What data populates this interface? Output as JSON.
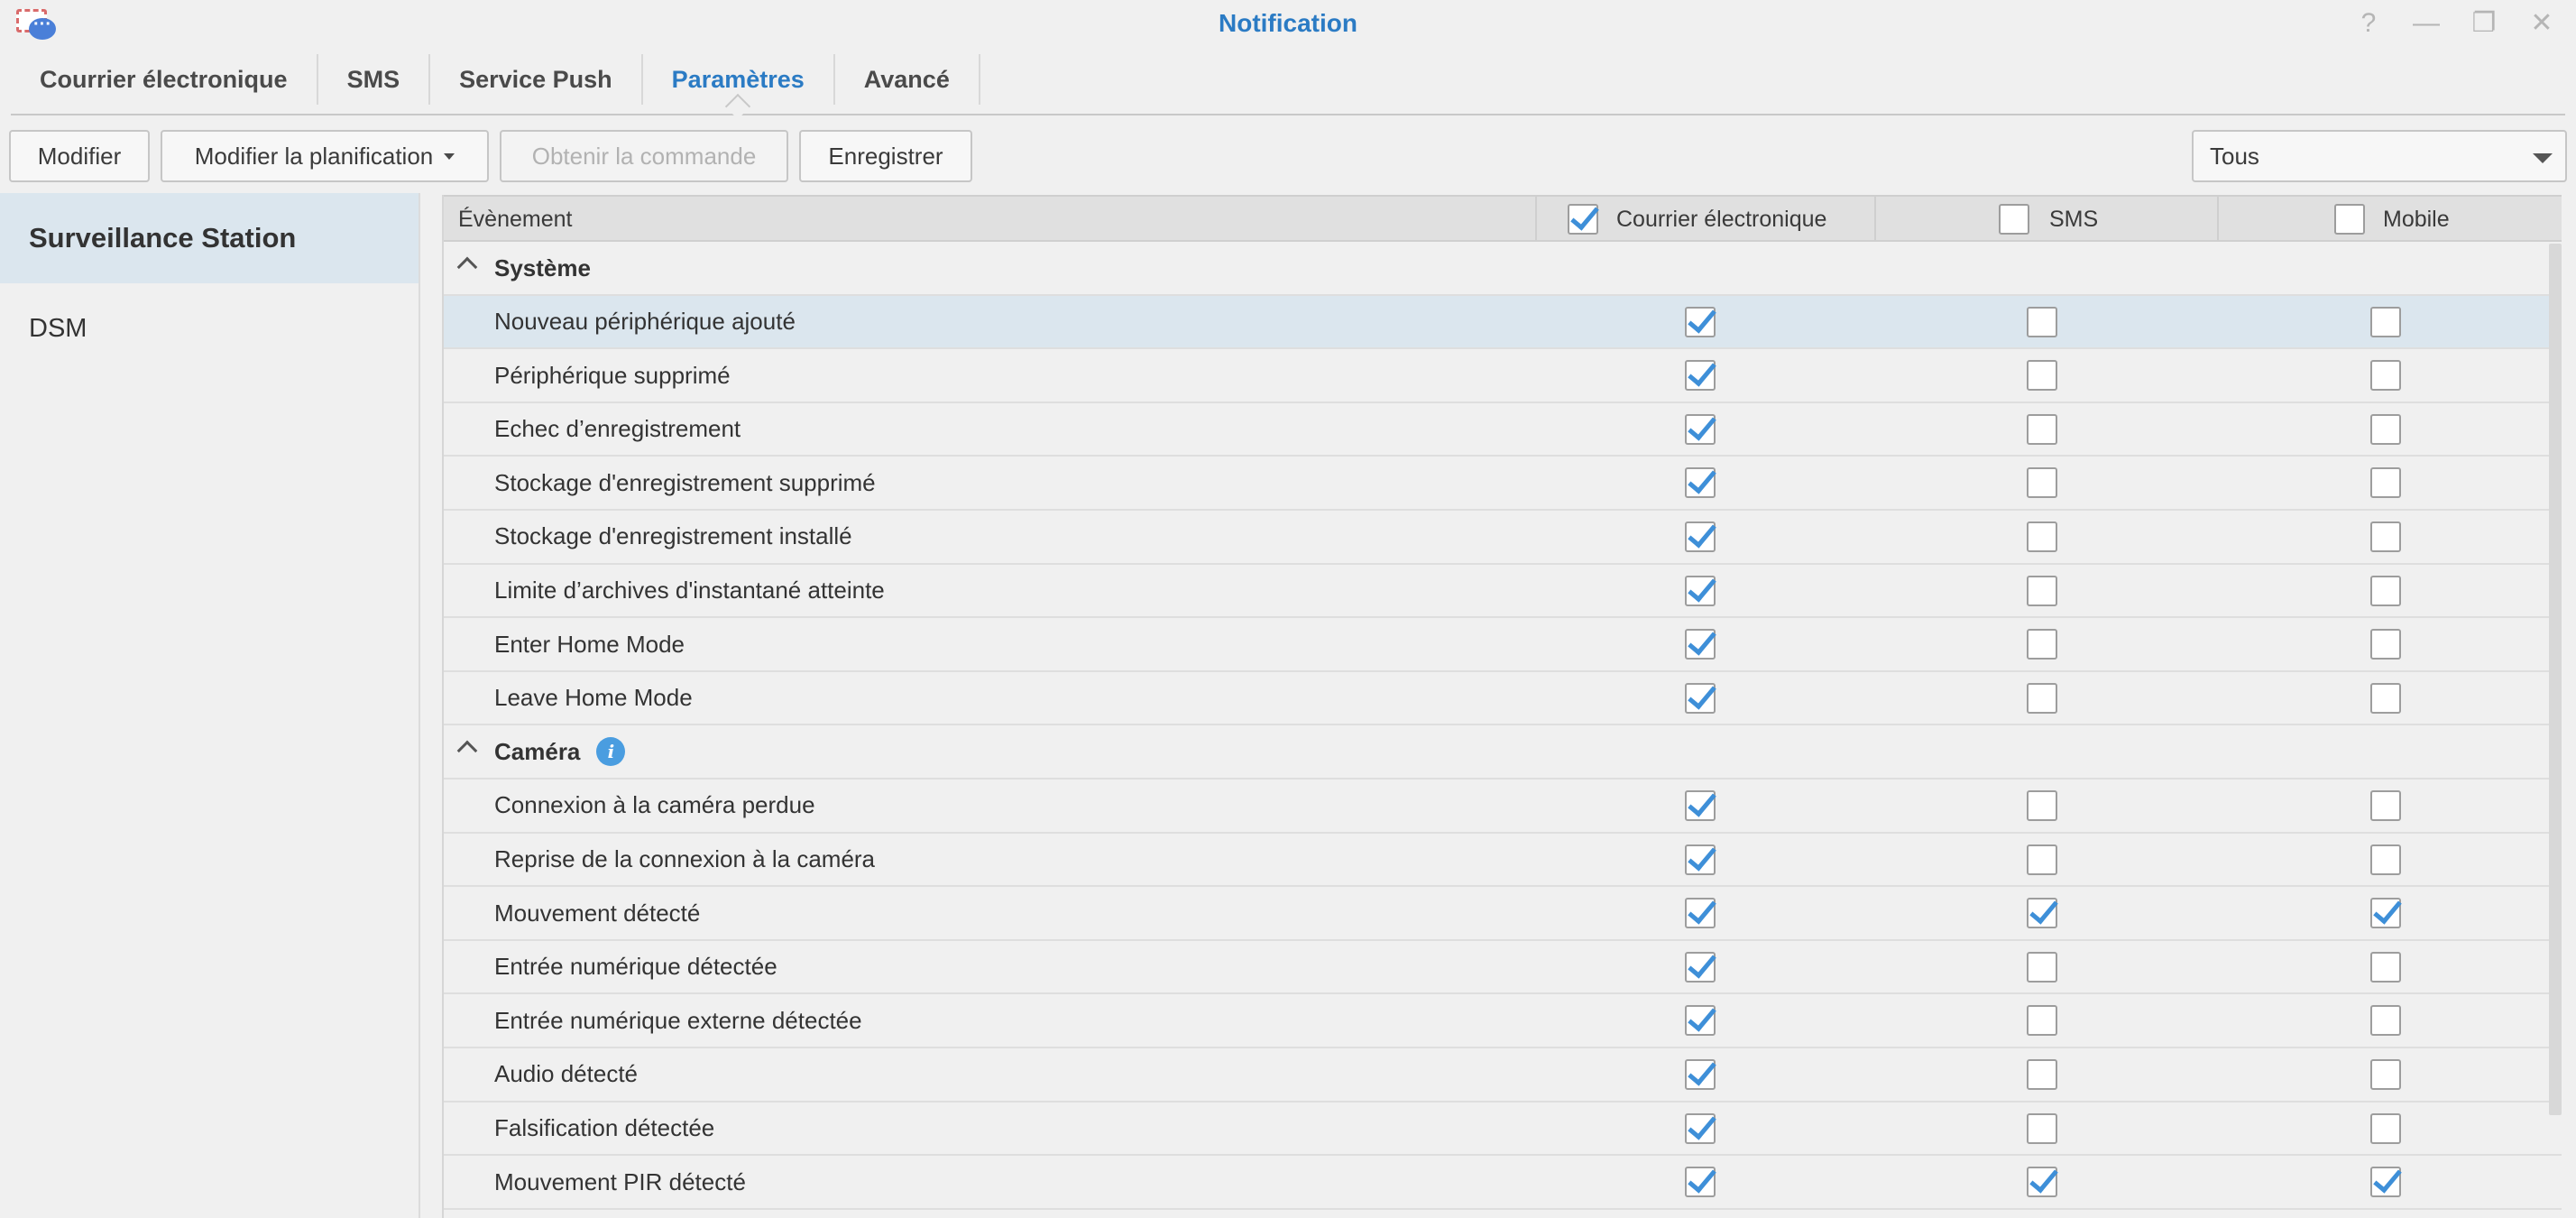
{
  "window": {
    "title": "Notification",
    "controls": [
      "help-icon",
      "minimize-icon",
      "restore-icon",
      "close-icon"
    ]
  },
  "tabs": [
    {
      "label": "Courrier électronique",
      "active": false
    },
    {
      "label": "SMS",
      "active": false
    },
    {
      "label": "Service Push",
      "active": false
    },
    {
      "label": "Paramètres",
      "active": true
    },
    {
      "label": "Avancé",
      "active": false
    }
  ],
  "toolbar": {
    "edit": "Modifier",
    "edit_schedule": "Modifier la planification",
    "get_command": "Obtenir la commande",
    "save": "Enregistrer",
    "filter_value": "Tous"
  },
  "sidebar": {
    "items": [
      {
        "label": "Surveillance Station",
        "active": true
      },
      {
        "label": "DSM",
        "active": false
      }
    ]
  },
  "grid": {
    "columns": {
      "event": "Évènement",
      "email": {
        "label": "Courrier électronique",
        "checked": true
      },
      "sms": {
        "label": "SMS",
        "checked": false
      },
      "mobile": {
        "label": "Mobile",
        "checked": false
      }
    },
    "groups": [
      {
        "label": "Système",
        "info": false,
        "rows": [
          {
            "label": "Nouveau périphérique ajouté",
            "email": true,
            "sms": false,
            "mobile": false,
            "selected": true
          },
          {
            "label": "Périphérique supprimé",
            "email": true,
            "sms": false,
            "mobile": false
          },
          {
            "label": "Echec d’enregistrement",
            "email": true,
            "sms": false,
            "mobile": false
          },
          {
            "label": "Stockage d'enregistrement supprimé",
            "email": true,
            "sms": false,
            "mobile": false
          },
          {
            "label": "Stockage d'enregistrement installé",
            "email": true,
            "sms": false,
            "mobile": false
          },
          {
            "label": "Limite d’archives d'instantané atteinte",
            "email": true,
            "sms": false,
            "mobile": false
          },
          {
            "label": "Enter Home Mode",
            "email": true,
            "sms": false,
            "mobile": false
          },
          {
            "label": "Leave Home Mode",
            "email": true,
            "sms": false,
            "mobile": false
          }
        ]
      },
      {
        "label": "Caméra",
        "info": true,
        "rows": [
          {
            "label": "Connexion à la caméra perdue",
            "email": true,
            "sms": false,
            "mobile": false
          },
          {
            "label": "Reprise de la connexion à la caméra",
            "email": true,
            "sms": false,
            "mobile": false
          },
          {
            "label": "Mouvement détecté",
            "email": true,
            "sms": true,
            "mobile": true
          },
          {
            "label": "Entrée numérique détectée",
            "email": true,
            "sms": false,
            "mobile": false
          },
          {
            "label": "Entrée numérique externe détectée",
            "email": true,
            "sms": false,
            "mobile": false
          },
          {
            "label": "Audio détecté",
            "email": true,
            "sms": false,
            "mobile": false
          },
          {
            "label": "Falsification détectée",
            "email": true,
            "sms": false,
            "mobile": false
          },
          {
            "label": "Mouvement PIR détecté",
            "email": true,
            "sms": true,
            "mobile": true
          },
          {
            "label": "",
            "email": true,
            "sms": false,
            "mobile": false
          }
        ]
      }
    ]
  },
  "colors": {
    "accent": "#2b7bc4",
    "check": "#3e8fd8",
    "selected_row": "#dbe6ee"
  }
}
